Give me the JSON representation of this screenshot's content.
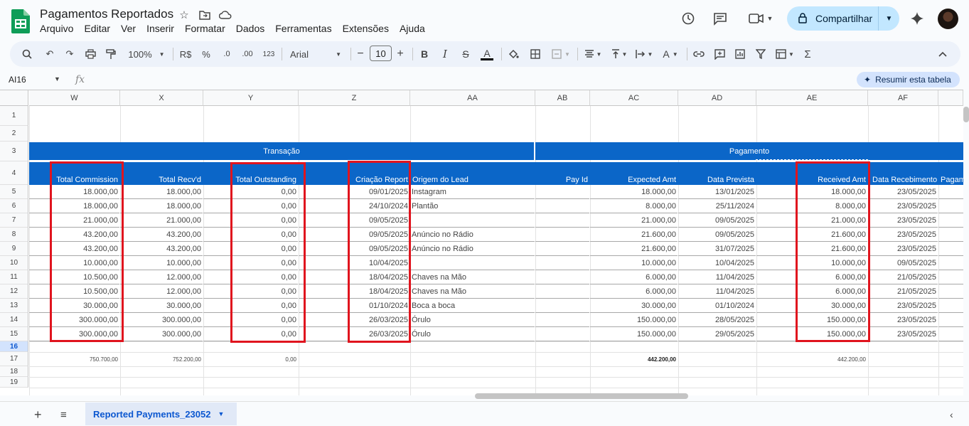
{
  "app": {
    "title": "Pagamentos Reportados",
    "menu": [
      "Arquivo",
      "Editar",
      "Ver",
      "Inserir",
      "Formatar",
      "Dados",
      "Ferramentas",
      "Extensões",
      "Ajuda"
    ],
    "share_label": "Compartilhar"
  },
  "toolbar": {
    "zoom": "100%",
    "currency": "R$",
    "percent": "%",
    "dec_decrease": ".0",
    "dec_increase": ".00",
    "format_123": "123",
    "font": "Arial",
    "font_size": "10"
  },
  "formula_bar": {
    "cell_ref": "AI16",
    "fx": "fx",
    "summarize_label": "Resumir esta tabela"
  },
  "columns": [
    "W",
    "X",
    "Y",
    "Z",
    "AA",
    "AB",
    "AC",
    "AD",
    "AE",
    "AF"
  ],
  "rows": [
    "1",
    "2",
    "3",
    "4",
    "5",
    "6",
    "7",
    "8",
    "9",
    "10",
    "11",
    "12",
    "13",
    "14",
    "15",
    "16",
    "17",
    "18",
    "19"
  ],
  "bands": {
    "transacao": "Transação",
    "pagamento": "Pagamento"
  },
  "headers": {
    "W": "Total Commission",
    "X": "Total Recv'd",
    "Y": "Total Outstanding",
    "Z": "Criação Report",
    "AA": "Origem do Lead",
    "AB": "Pay Id",
    "AC": "Expected Amt",
    "AD": "Data Prevista",
    "AE": "Received Amt",
    "AF": "Data Recebimento",
    "AG": "Pagam"
  },
  "data_rows": [
    {
      "W": "18.000,00",
      "X": "18.000,00",
      "Y": "0,00",
      "Z": "09/01/2025",
      "AA": "Instagram",
      "AC": "18.000,00",
      "AD": "13/01/2025",
      "AE": "18.000,00",
      "AF": "23/05/2025"
    },
    {
      "W": "18.000,00",
      "X": "18.000,00",
      "Y": "0,00",
      "Z": "24/10/2024",
      "AA": "Plantão",
      "AC": "8.000,00",
      "AD": "25/11/2024",
      "AE": "8.000,00",
      "AF": "23/05/2025"
    },
    {
      "W": "21.000,00",
      "X": "21.000,00",
      "Y": "0,00",
      "Z": "09/05/2025",
      "AA": "",
      "AC": "21.000,00",
      "AD": "09/05/2025",
      "AE": "21.000,00",
      "AF": "23/05/2025"
    },
    {
      "W": "43.200,00",
      "X": "43.200,00",
      "Y": "0,00",
      "Z": "09/05/2025",
      "AA": "Anúncio no Rádio",
      "AC": "21.600,00",
      "AD": "09/05/2025",
      "AE": "21.600,00",
      "AF": "23/05/2025"
    },
    {
      "W": "43.200,00",
      "X": "43.200,00",
      "Y": "0,00",
      "Z": "09/05/2025",
      "AA": "Anúncio no Rádio",
      "AC": "21.600,00",
      "AD": "31/07/2025",
      "AE": "21.600,00",
      "AF": "23/05/2025"
    },
    {
      "W": "10.000,00",
      "X": "10.000,00",
      "Y": "0,00",
      "Z": "10/04/2025",
      "AA": "",
      "AC": "10.000,00",
      "AD": "10/04/2025",
      "AE": "10.000,00",
      "AF": "09/05/2025"
    },
    {
      "W": "10.500,00",
      "X": "12.000,00",
      "Y": "0,00",
      "Z": "18/04/2025",
      "AA": "Chaves na Mão",
      "AC": "6.000,00",
      "AD": "11/04/2025",
      "AE": "6.000,00",
      "AF": "21/05/2025"
    },
    {
      "W": "10.500,00",
      "X": "12.000,00",
      "Y": "0,00",
      "Z": "18/04/2025",
      "AA": "Chaves na Mão",
      "AC": "6.000,00",
      "AD": "11/04/2025",
      "AE": "6.000,00",
      "AF": "21/05/2025"
    },
    {
      "W": "30.000,00",
      "X": "30.000,00",
      "Y": "0,00",
      "Z": "01/10/2024",
      "AA": "Boca a boca",
      "AC": "30.000,00",
      "AD": "01/10/2024",
      "AE": "30.000,00",
      "AF": "23/05/2025"
    },
    {
      "W": "300.000,00",
      "X": "300.000,00",
      "Y": "0,00",
      "Z": "26/03/2025",
      "AA": "Órulo",
      "AC": "150.000,00",
      "AD": "28/05/2025",
      "AE": "150.000,00",
      "AF": "23/05/2025"
    },
    {
      "W": "300.000,00",
      "X": "300.000,00",
      "Y": "0,00",
      "Z": "26/03/2025",
      "AA": "Órulo",
      "AC": "150.000,00",
      "AD": "29/05/2025",
      "AE": "150.000,00",
      "AF": "23/05/2025"
    }
  ],
  "totals": {
    "W": "750.700,00",
    "X": "752.200,00",
    "Y": "0,00",
    "AC": "442.200,00",
    "AE": "442.200,00"
  },
  "sheet_tab": {
    "name": "Reported Payments_23052"
  },
  "colors": {
    "header_band": "#0b66c8",
    "highlight_box": "#e0141e",
    "share_bg": "#c2e7ff"
  }
}
